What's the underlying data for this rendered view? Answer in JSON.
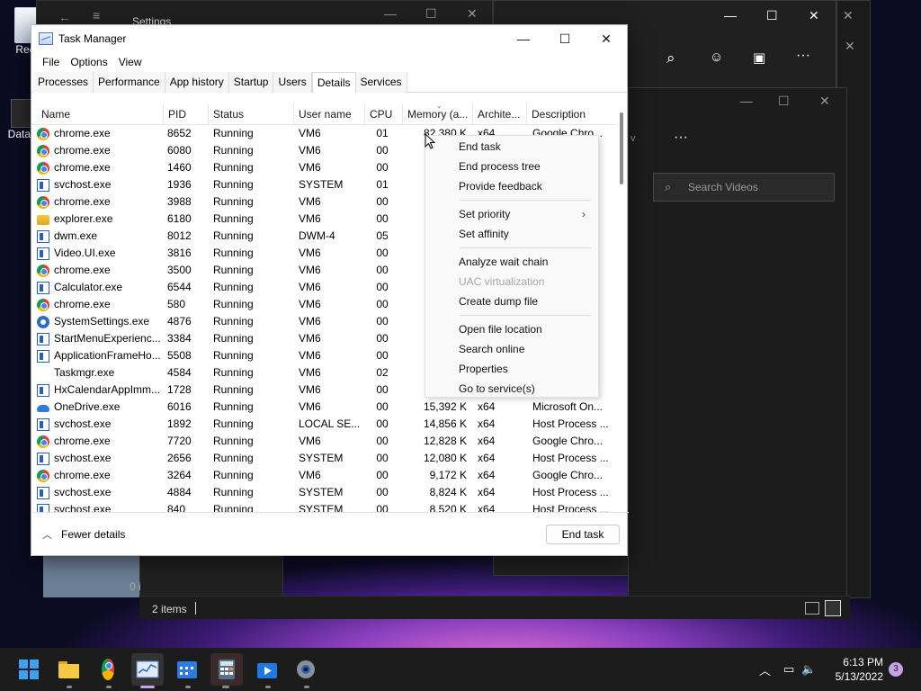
{
  "desktop": {
    "icons": [
      {
        "label": "Recy"
      },
      {
        "label": "DataW"
      }
    ]
  },
  "background": {
    "settings_title": "Settings",
    "explorer_search_placeholder": "Search Videos",
    "explorer_status_items": "2 items",
    "left_thumb_text": "0 i"
  },
  "task_manager": {
    "title": "Task Manager",
    "menu": [
      "File",
      "Options",
      "View"
    ],
    "tabs": [
      "Processes",
      "Performance",
      "App history",
      "Startup",
      "Users",
      "Details",
      "Services"
    ],
    "active_tab": "Details",
    "columns": [
      "Name",
      "PID",
      "Status",
      "User name",
      "CPU",
      "Memory (a...",
      "Archite...",
      "Description"
    ],
    "rows": [
      {
        "icon": "chrome-icon",
        "name": "chrome.exe",
        "pid": "8652",
        "status": "Running",
        "user": "VM6",
        "cpu": "01",
        "mem": "82,380 K",
        "arch": "x64",
        "desc": "Google Chro..."
      },
      {
        "icon": "chrome-icon",
        "name": "chrome.exe",
        "pid": "6080",
        "status": "Running",
        "user": "VM6",
        "cpu": "00",
        "mem": "",
        "arch": "",
        "desc": ""
      },
      {
        "icon": "chrome-icon",
        "name": "chrome.exe",
        "pid": "1460",
        "status": "Running",
        "user": "VM6",
        "cpu": "00",
        "mem": "",
        "arch": "",
        "desc": ""
      },
      {
        "icon": "window-icon",
        "name": "svchost.exe",
        "pid": "1936",
        "status": "Running",
        "user": "SYSTEM",
        "cpu": "01",
        "mem": "",
        "arch": "",
        "desc": ""
      },
      {
        "icon": "chrome-icon",
        "name": "chrome.exe",
        "pid": "3988",
        "status": "Running",
        "user": "VM6",
        "cpu": "00",
        "mem": "",
        "arch": "",
        "desc": ""
      },
      {
        "icon": "folder-icon",
        "name": "explorer.exe",
        "pid": "6180",
        "status": "Running",
        "user": "VM6",
        "cpu": "00",
        "mem": "",
        "arch": "",
        "desc": ""
      },
      {
        "icon": "window-icon",
        "name": "dwm.exe",
        "pid": "8012",
        "status": "Running",
        "user": "DWM-4",
        "cpu": "05",
        "mem": "",
        "arch": "",
        "desc": ""
      },
      {
        "icon": "window-icon",
        "name": "Video.UI.exe",
        "pid": "3816",
        "status": "Running",
        "user": "VM6",
        "cpu": "00",
        "mem": "",
        "arch": "",
        "desc": ""
      },
      {
        "icon": "chrome-icon",
        "name": "chrome.exe",
        "pid": "3500",
        "status": "Running",
        "user": "VM6",
        "cpu": "00",
        "mem": "",
        "arch": "",
        "desc": ""
      },
      {
        "icon": "window-icon",
        "name": "Calculator.exe",
        "pid": "6544",
        "status": "Running",
        "user": "VM6",
        "cpu": "00",
        "mem": "",
        "arch": "",
        "desc": ""
      },
      {
        "icon": "chrome-icon",
        "name": "chrome.exe",
        "pid": "580",
        "status": "Running",
        "user": "VM6",
        "cpu": "00",
        "mem": "",
        "arch": "",
        "desc": ""
      },
      {
        "icon": "gear-icon",
        "name": "SystemSettings.exe",
        "pid": "4876",
        "status": "Running",
        "user": "VM6",
        "cpu": "00",
        "mem": "",
        "arch": "",
        "desc": ""
      },
      {
        "icon": "window-icon",
        "name": "StartMenuExperienc...",
        "pid": "3384",
        "status": "Running",
        "user": "VM6",
        "cpu": "00",
        "mem": "",
        "arch": "",
        "desc": ""
      },
      {
        "icon": "window-icon",
        "name": "ApplicationFrameHo...",
        "pid": "5508",
        "status": "Running",
        "user": "VM6",
        "cpu": "00",
        "mem": "",
        "arch": "",
        "desc": ""
      },
      {
        "icon": "taskmgr-icon",
        "name": "Taskmgr.exe",
        "pid": "4584",
        "status": "Running",
        "user": "VM6",
        "cpu": "02",
        "mem": "",
        "arch": "",
        "desc": ""
      },
      {
        "icon": "window-icon",
        "name": "HxCalendarAppImm...",
        "pid": "1728",
        "status": "Running",
        "user": "VM6",
        "cpu": "00",
        "mem": "",
        "arch": "",
        "desc": ""
      },
      {
        "icon": "onedrive-icon",
        "name": "OneDrive.exe",
        "pid": "6016",
        "status": "Running",
        "user": "VM6",
        "cpu": "00",
        "mem": "15,392 K",
        "arch": "x64",
        "desc": "Microsoft On..."
      },
      {
        "icon": "window-icon",
        "name": "svchost.exe",
        "pid": "1892",
        "status": "Running",
        "user": "LOCAL SE...",
        "cpu": "00",
        "mem": "14,856 K",
        "arch": "x64",
        "desc": "Host Process ..."
      },
      {
        "icon": "chrome-icon",
        "name": "chrome.exe",
        "pid": "7720",
        "status": "Running",
        "user": "VM6",
        "cpu": "00",
        "mem": "12,828 K",
        "arch": "x64",
        "desc": "Google Chro..."
      },
      {
        "icon": "window-icon",
        "name": "svchost.exe",
        "pid": "2656",
        "status": "Running",
        "user": "SYSTEM",
        "cpu": "00",
        "mem": "12,080 K",
        "arch": "x64",
        "desc": "Host Process ..."
      },
      {
        "icon": "chrome-icon",
        "name": "chrome.exe",
        "pid": "3264",
        "status": "Running",
        "user": "VM6",
        "cpu": "00",
        "mem": "9,172 K",
        "arch": "x64",
        "desc": "Google Chro..."
      },
      {
        "icon": "window-icon",
        "name": "svchost.exe",
        "pid": "4884",
        "status": "Running",
        "user": "SYSTEM",
        "cpu": "00",
        "mem": "8,824 K",
        "arch": "x64",
        "desc": "Host Process ..."
      },
      {
        "icon": "window-icon",
        "name": "svchost.exe",
        "pid": "840",
        "status": "Running",
        "user": "SYSTEM",
        "cpu": "00",
        "mem": "8,520 K",
        "arch": "x64",
        "desc": "Host Process ..."
      }
    ],
    "fewer_details": "Fewer details",
    "end_task_button": "End task"
  },
  "context_menu": {
    "items": [
      {
        "label": "End task",
        "enabled": true
      },
      {
        "label": "End process tree",
        "enabled": true
      },
      {
        "label": "Provide feedback",
        "enabled": true
      },
      {
        "label": "Set priority",
        "enabled": true,
        "submenu": true
      },
      {
        "label": "Set affinity",
        "enabled": true
      },
      {
        "label": "Analyze wait chain",
        "enabled": true
      },
      {
        "label": "UAC virtualization",
        "enabled": false
      },
      {
        "label": "Create dump file",
        "enabled": true
      },
      {
        "label": "Open file location",
        "enabled": true
      },
      {
        "label": "Search online",
        "enabled": true
      },
      {
        "label": "Properties",
        "enabled": true
      },
      {
        "label": "Go to service(s)",
        "enabled": true
      }
    ]
  },
  "taskbar": {
    "clock_time": "6:13 PM",
    "clock_date": "5/13/2022",
    "notification_count": "3",
    "pinned": [
      "start-icon",
      "file-explorer-icon",
      "chrome-icon",
      "task-manager-icon",
      "calendar-icon",
      "calculator-icon",
      "movies-tv-icon",
      "settings-icon"
    ]
  },
  "colors": {
    "accent": "#2b5fb4",
    "taskbar": "#1c1c1c"
  }
}
